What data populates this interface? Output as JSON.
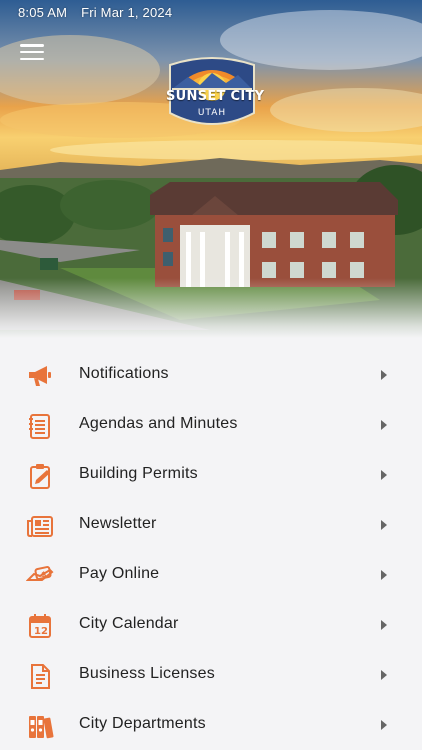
{
  "status_bar": {
    "time": "8:05 AM",
    "date": "Fri Mar 1, 2024"
  },
  "logo": {
    "title": "SUNSET CITY",
    "subtitle": "UTAH"
  },
  "colors": {
    "accent": "#e8743b",
    "background": "#f4f4f6",
    "text": "#222222"
  },
  "menu": [
    {
      "label": "Notifications",
      "icon": "megaphone-icon"
    },
    {
      "label": "Agendas and Minutes",
      "icon": "notepad-icon"
    },
    {
      "label": "Building Permits",
      "icon": "clipboard-icon"
    },
    {
      "label": "Newsletter",
      "icon": "newspaper-icon"
    },
    {
      "label": "Pay Online",
      "icon": "money-icon"
    },
    {
      "label": "City Calendar",
      "icon": "calendar-icon"
    },
    {
      "label": "Business Licenses",
      "icon": "document-icon"
    },
    {
      "label": "City Departments",
      "icon": "binders-icon"
    }
  ]
}
